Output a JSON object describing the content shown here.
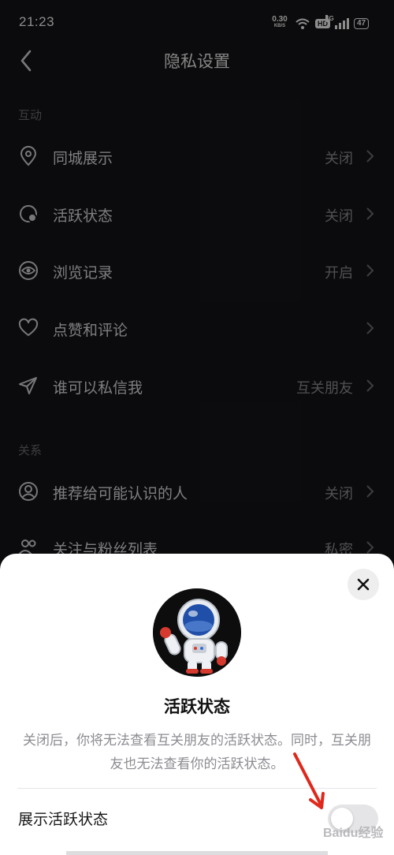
{
  "status_bar": {
    "time": "21:23",
    "net_speed": "0.30",
    "net_unit": "KB/S",
    "hd": "HD",
    "network": "4G",
    "battery": "47"
  },
  "header": {
    "title": "隐私设置"
  },
  "sections": {
    "interaction": "互动",
    "relations": "关系"
  },
  "rows": [
    {
      "icon": "location-pin-icon",
      "label": "同城展示",
      "value": "关闭"
    },
    {
      "icon": "activity-status-icon",
      "label": "活跃状态",
      "value": "关闭"
    },
    {
      "icon": "eye-icon",
      "label": "浏览记录",
      "value": "开启"
    },
    {
      "icon": "heart-icon",
      "label": "点赞和评论",
      "value": ""
    },
    {
      "icon": "send-icon",
      "label": "谁可以私信我",
      "value": "互关朋友"
    },
    {
      "icon": "person-circle-icon",
      "label": "推荐给可能认识的人",
      "value": "关闭"
    },
    {
      "icon": "people-icon",
      "label": "关注与粉丝列表",
      "value": "私密"
    }
  ],
  "sheet": {
    "title": "活跃状态",
    "description": "关闭后，你将无法查看互关朋友的活跃状态。同时，互关朋友也无法查看你的活跃状态。",
    "toggle_label": "展示活跃状态",
    "toggle_on": false,
    "watermark": "Baidu经验"
  },
  "colors": {
    "background": "#141418",
    "sheet": "#ffffff",
    "annotation_arrow": "#e0281c"
  }
}
